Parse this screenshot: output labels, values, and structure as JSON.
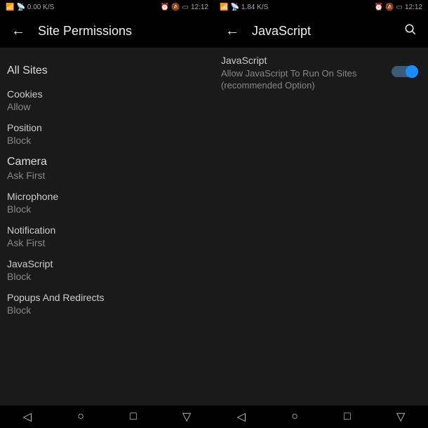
{
  "status_left": {
    "speed1": "0.00 K/S",
    "speed2": "1.84 K/S"
  },
  "status_right": {
    "time": "12:12"
  },
  "left": {
    "title": "Site Permissions",
    "section": "All Sites",
    "items": [
      {
        "label": "Cookies",
        "value": "Allow"
      },
      {
        "label": "Position",
        "value": "Block"
      },
      {
        "label": "Camera",
        "value": "Ask First"
      },
      {
        "label": "Microphone",
        "value": "Block"
      },
      {
        "label": "Notification",
        "value": "Ask First"
      },
      {
        "label": "JavaScript",
        "value": "Block"
      },
      {
        "label": "Popups And Redirects",
        "value": "Block"
      }
    ]
  },
  "right": {
    "title": "JavaScript",
    "setting_title": "JavaScript",
    "setting_desc": "Allow JavaScript To Run On Sites (recommended Option)"
  }
}
